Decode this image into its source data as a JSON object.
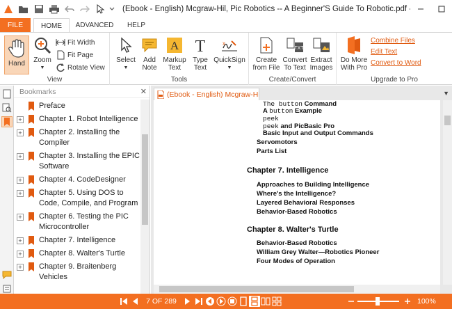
{
  "title_bar": {
    "title": "(Ebook - English) Mcgraw-Hil, Pic Robotics -- A Beginner'S Guide To Robotic.pdf - Nit..."
  },
  "tabs": {
    "file": "FILE",
    "home": "HOME",
    "advanced": "ADVANCED",
    "help": "HELP"
  },
  "ribbon": {
    "view": {
      "label": "View",
      "hand": "Hand",
      "zoom": "Zoom",
      "fit_width": "Fit Width",
      "fit_page": "Fit Page",
      "rotate_view": "Rotate View"
    },
    "tools": {
      "label": "Tools",
      "select": "Select",
      "add_note": [
        "Add",
        "Note"
      ],
      "markup_text": [
        "Markup",
        "Text"
      ],
      "type_text": [
        "Type",
        "Text"
      ],
      "quicksign": "QuickSign"
    },
    "create_convert": {
      "label": "Create/Convert",
      "create_from_file": [
        "Create",
        "from File"
      ],
      "convert_to_text": [
        "Convert",
        "To Text"
      ],
      "extract_images": [
        "Extract",
        "Images"
      ]
    },
    "upgrade": {
      "label": "Upgrade to Pro",
      "do_more": [
        "Do More",
        "With Pro"
      ],
      "combine_files": "Combine Files",
      "edit_text": "Edit Text",
      "convert_to_word": "Convert to Word"
    }
  },
  "bookmarks": {
    "header": "Bookmarks",
    "items": [
      {
        "label": "Preface",
        "expandable": false
      },
      {
        "label": "Chapter 1. Robot Intelligence",
        "expandable": true
      },
      {
        "label": "Chapter 2. Installing the Compiler",
        "expandable": true
      },
      {
        "label": "Chapter 3. Installing the EPIC Software",
        "expandable": true
      },
      {
        "label": "Chapter 4. CodeDesigner",
        "expandable": true
      },
      {
        "label": "Chapter 5. Using DOS to Code, Compile, and Program",
        "expandable": true
      },
      {
        "label": "Chapter 6. Testing the PIC Microcontroller",
        "expandable": true
      },
      {
        "label": "Chapter 7. Intelligence",
        "expandable": true
      },
      {
        "label": "Chapter 8. Walter's Turtle",
        "expandable": true
      },
      {
        "label": "Chapter 9. Braitenberg Vehicles",
        "expandable": true
      }
    ]
  },
  "document": {
    "tab_label": "(Ebook - English) Mcgraw-Hil, Pic...",
    "lines": {
      "l1_mono": "The button",
      "l1_rest": " Command",
      "l2_pre": "A ",
      "l2_mono": "button",
      "l2_rest": " Example",
      "l3_mono": "peek",
      "l4_mono": "peek",
      "l4_rest": " and PicBasic Pro",
      "l5": "Basic Input and Output Commands",
      "l6": "Servomotors",
      "l7": "Parts List",
      "ch7": "Chapter 7.  Intelligence",
      "c7a": "Approaches to Building Intelligence",
      "c7b": "Where's the Intelligence?",
      "c7c": "Layered Behavioral Responses",
      "c7d": "Behavior-Based Robotics",
      "ch8": "Chapter 8.  Walter's Turtle",
      "c8a": "Behavior-Based Robotics",
      "c8b": "William Grey Walter—Robotics Pioneer",
      "c8c": "Four Modes of Operation"
    }
  },
  "status_bar": {
    "page": "7 OF 289",
    "zoom": "100%"
  },
  "colors": {
    "accent": "#f36f21",
    "link": "#e05a10"
  }
}
